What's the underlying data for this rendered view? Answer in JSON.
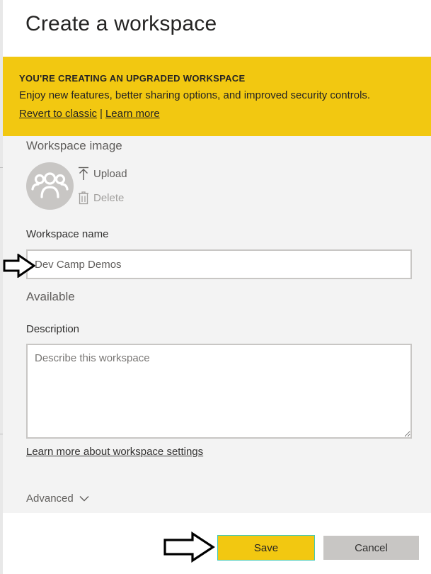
{
  "dialog": {
    "title": "Create a workspace"
  },
  "banner": {
    "heading": "YOU'RE CREATING AN UPGRADED WORKSPACE",
    "text": "Enjoy new features, better sharing options, and improved security controls.",
    "revert_link": "Revert to classic",
    "separator": "|",
    "learn_more_link": "Learn more",
    "color": "#f2c811"
  },
  "workspace_image": {
    "label": "Workspace image",
    "avatar_icon": "group-people-icon",
    "upload_label": "Upload",
    "delete_label": "Delete"
  },
  "workspace_name": {
    "label": "Workspace name",
    "value": "Dev Camp Demos",
    "availability": "Available"
  },
  "description": {
    "label": "Description",
    "placeholder": "Describe this workspace",
    "value": ""
  },
  "learn_settings_link": "Learn more about workspace settings",
  "advanced": {
    "label": "Advanced"
  },
  "footer": {
    "save_label": "Save",
    "cancel_label": "Cancel"
  },
  "colors": {
    "accent": "#f2c811",
    "panel_background": "#f3f3f3",
    "cancel_button": "#c8c6c4"
  }
}
